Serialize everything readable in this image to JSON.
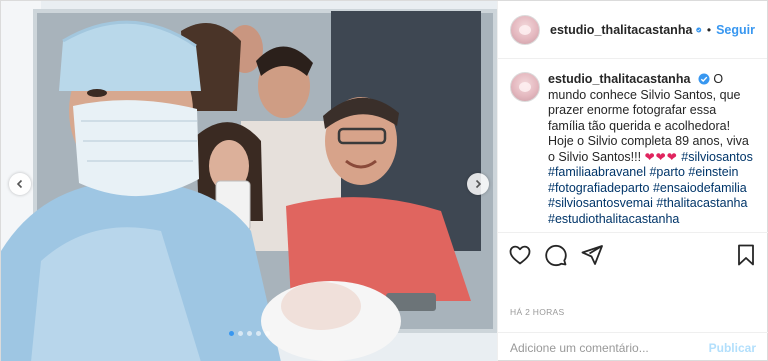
{
  "post": {
    "username": "estudio_thalitacastanha",
    "verified": true,
    "separator": "•",
    "follow_label": "Seguir",
    "caption": {
      "username": "estudio_thalitacastanha",
      "text": "O mundo conhece Silvio Santos, que prazer enorme fotografar essa família tão querida e acolhedora! Hoje o Silvio completa 89 anos, viva o Silvio Santos!!!",
      "hearts": "❤❤❤",
      "hashtags": [
        "#silviosantos",
        "#familiaabravanel",
        "#parto",
        "#einstein",
        "#fotografiadeparto",
        "#ensaiodefamilia",
        "#silviosantosvemai",
        "#thalitacastanha",
        "#estudiothalitacastanha"
      ]
    },
    "timestamp": "HÁ 2 HORAS",
    "comment_placeholder": "Adicione um comentário...",
    "publish_label": "Publicar",
    "carousel": {
      "count": 5,
      "active_index": 0
    },
    "colors": {
      "link": "#3897f0",
      "hashtag": "#003569",
      "heart": "#e0245e",
      "publish_disabled": "#b2dffc"
    },
    "icons": [
      "verified-badge-icon",
      "heart-icon",
      "comment-icon",
      "share-icon",
      "bookmark-icon",
      "chevron-left-icon",
      "chevron-right-icon"
    ]
  }
}
